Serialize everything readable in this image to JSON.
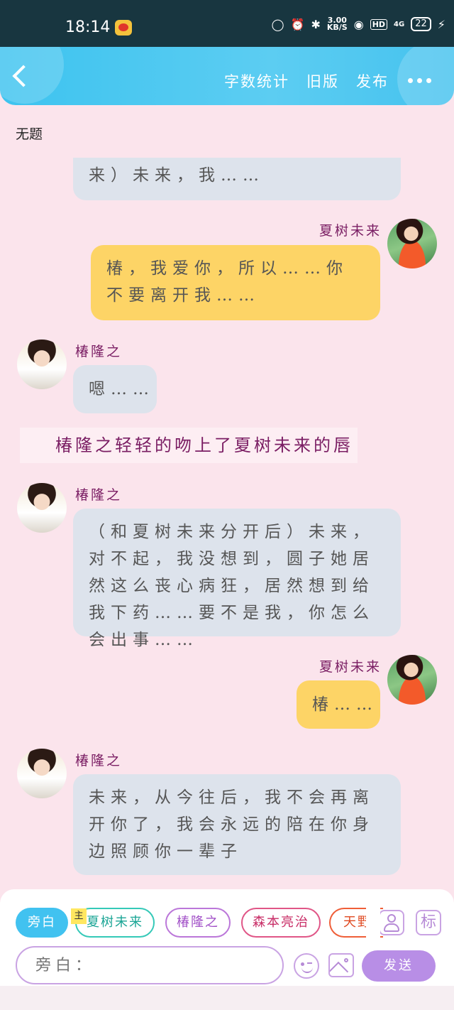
{
  "status_bar": {
    "time": "18:14",
    "speed_value": "3.00",
    "speed_unit": "KB/S",
    "hd": "HD",
    "signal": "4G",
    "battery": "22"
  },
  "header": {
    "word_count": "字数统计",
    "old_version": "旧版",
    "publish": "发布"
  },
  "doc_title": "无题",
  "messages": [
    {
      "side": "left",
      "text": "来）未来，我……"
    },
    {
      "side": "right",
      "name": "夏树未来",
      "text": "椿，我爱你，所以……你不要离开我……"
    },
    {
      "side": "left",
      "name": "椿隆之",
      "text": "嗯……"
    },
    {
      "side": "narration",
      "text": "椿隆之轻轻的吻上了夏树未来的唇"
    },
    {
      "side": "left",
      "name": "椿隆之",
      "text": "（和夏树未来分开后）未来，对不起，我没想到，圆子她居然这么丧心病狂，居然想到给我下药……要不是我，你怎么会出事……"
    },
    {
      "side": "right",
      "name": "夏树未来",
      "text": "椿……"
    },
    {
      "side": "left",
      "name": "椿隆之",
      "text": "未来，从今往后，我不会再离开你了，我会永远的陪在你身边照顾你一辈子"
    }
  ],
  "roles": {
    "narration": "旁白",
    "main_badge": "主",
    "role1": "夏树未来",
    "role2": "椿隆之",
    "role3": "森本亮治",
    "role4": "天野"
  },
  "toolbar": {
    "tag_label": "标",
    "send_label": "发送"
  },
  "input": {
    "placeholder": "旁白："
  },
  "colors": {
    "header": "#45c2ee",
    "chat_bg": "#fbe4ec",
    "left_bubble": "#dde3ec",
    "right_bubble": "#fdd466",
    "name": "#7a1d63",
    "send": "#b88ee6"
  }
}
